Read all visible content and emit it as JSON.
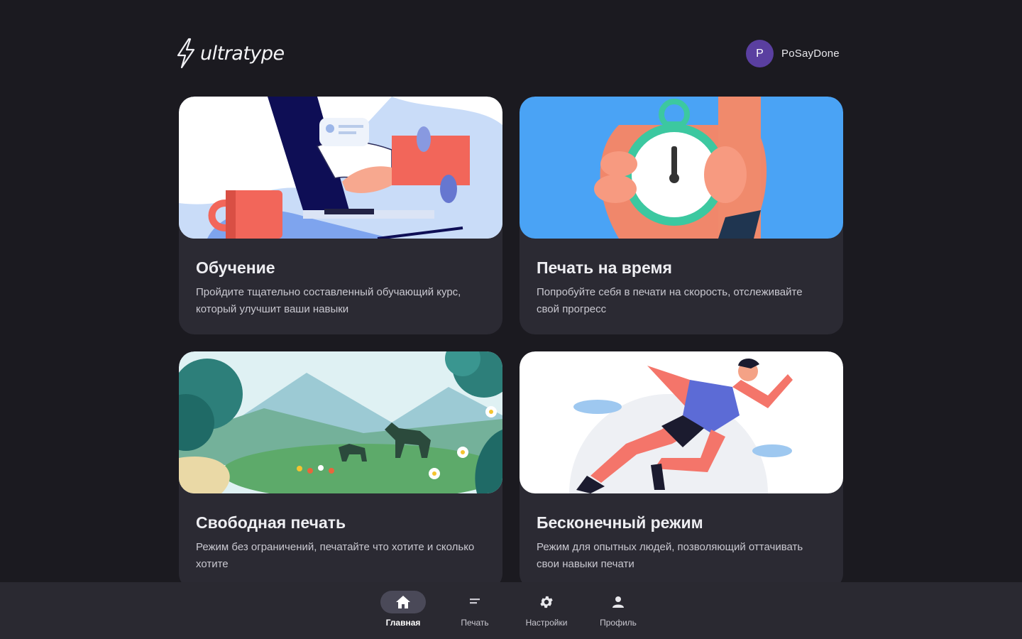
{
  "header": {
    "logo_text": "ultratype",
    "user": {
      "avatar_letter": "P",
      "name": "PoSayDone"
    }
  },
  "cards": [
    {
      "title": "Обучение",
      "description": "Пройдите тщательно составленный обучающий курс, который улучшит ваши навыки",
      "illustration": "laptop-typing-illustration"
    },
    {
      "title": "Печать на время",
      "description": "Попробуйте себя в печати на скорость, отслеживайте свой прогресс",
      "illustration": "stopwatch-illustration"
    },
    {
      "title": "Свободная печать",
      "description": "Режим без ограничений, печатайте что хотите и сколько хотите",
      "illustration": "deer-landscape-illustration"
    },
    {
      "title": "Бесконечный режим",
      "description": "Режим для опытных людей, позволяющий оттачивать свои навыки печати",
      "illustration": "runner-illustration"
    }
  ],
  "bottom_nav": {
    "items": [
      {
        "label": "Главная",
        "icon": "home-icon",
        "active": true
      },
      {
        "label": "Печать",
        "icon": "typing-icon",
        "active": false
      },
      {
        "label": "Настройки",
        "icon": "gear-icon",
        "active": false
      },
      {
        "label": "Профиль",
        "icon": "person-icon",
        "active": false
      }
    ]
  },
  "colors": {
    "background": "#1b1a20",
    "card": "#2b2a33",
    "nav_bar": "#2a2931",
    "avatar": "#5a3fa0",
    "active_pill": "#4a4958"
  }
}
